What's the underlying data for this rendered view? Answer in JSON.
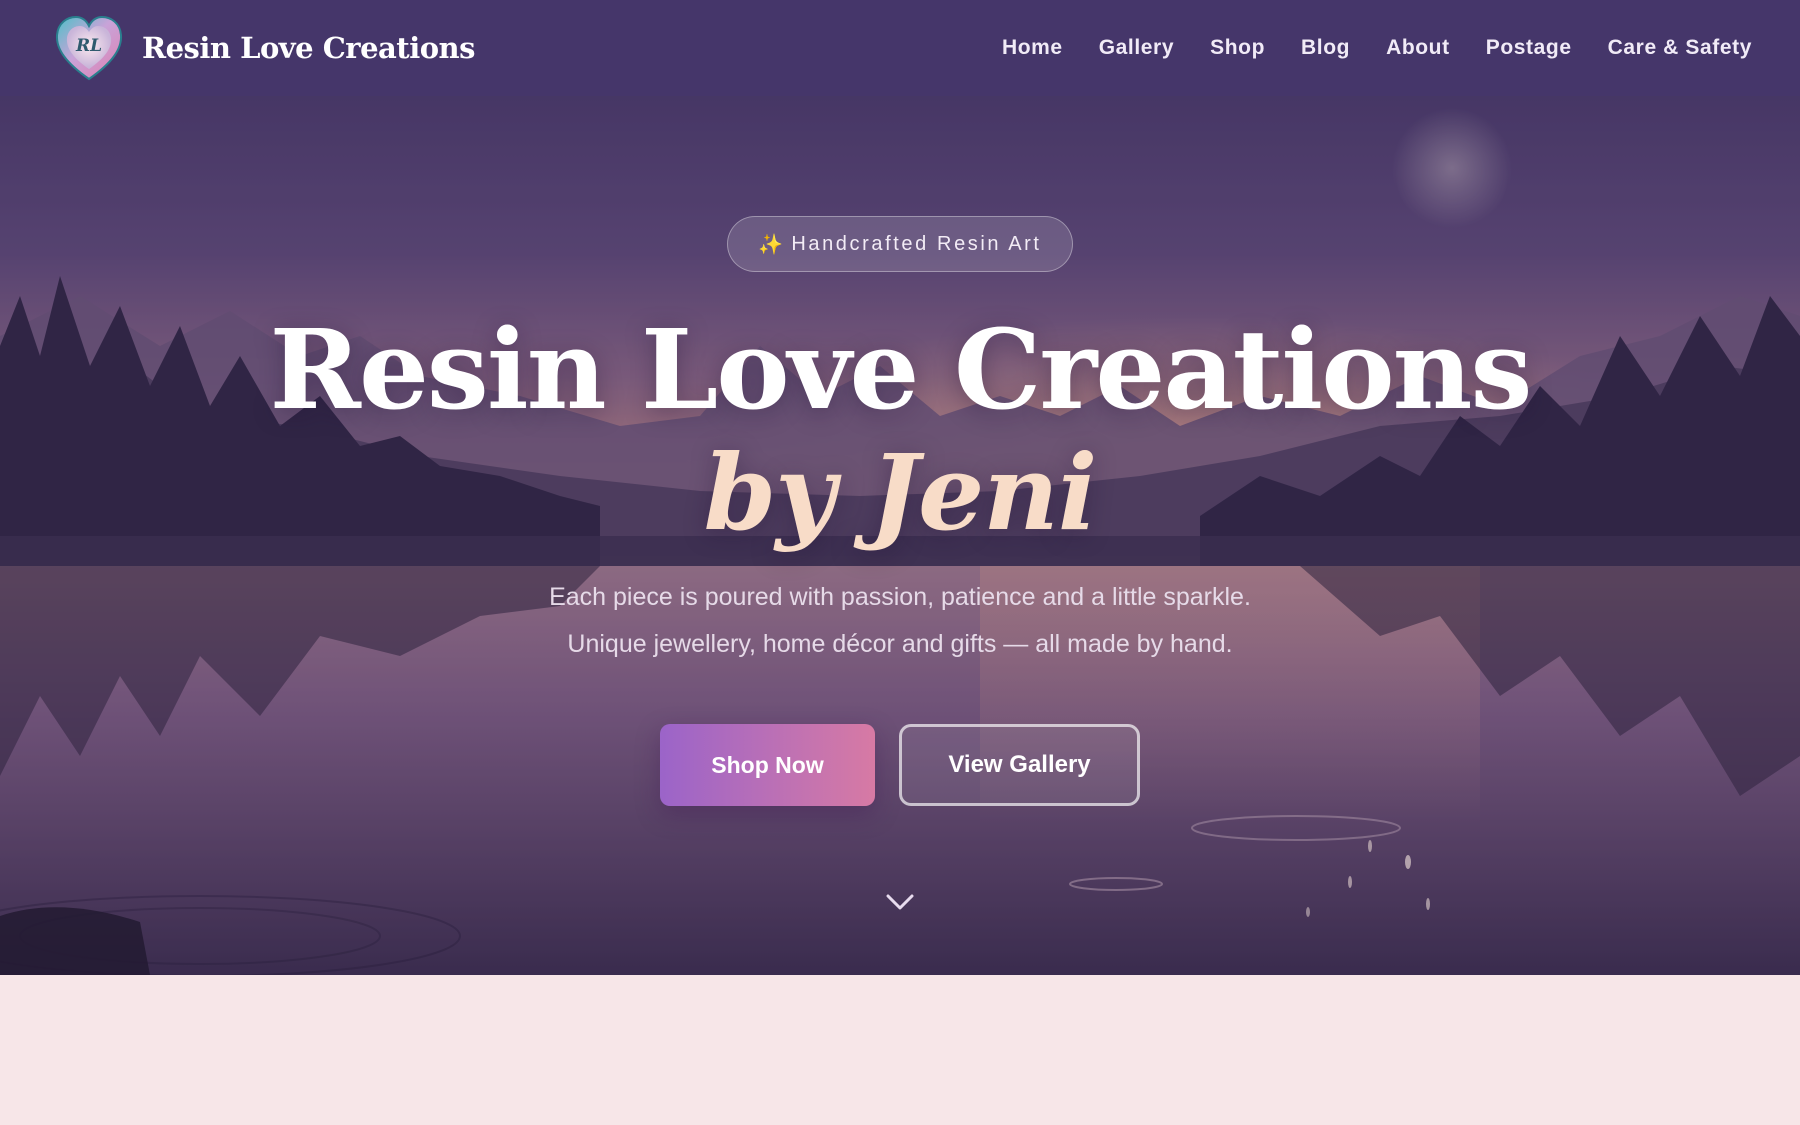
{
  "brand": {
    "name": "Resin Love Creations",
    "logo_monogram": "RL",
    "logo_icon": "heart-logo-icon"
  },
  "nav": {
    "items": [
      {
        "label": "Home"
      },
      {
        "label": "Gallery"
      },
      {
        "label": "Shop"
      },
      {
        "label": "Blog"
      },
      {
        "label": "About"
      },
      {
        "label": "Postage"
      },
      {
        "label": "Care & Safety"
      }
    ]
  },
  "hero": {
    "badge_icon": "✨",
    "badge_text": "Handcrafted Resin Art",
    "title": "Resin Love Creations",
    "subtitle": "by Jeni",
    "tagline_line1": "Each piece is poured with passion, patience and a little sparkle.",
    "tagline_line2": "Unique jewellery, home décor and gifts — all made by hand.",
    "primary_button": "Shop Now",
    "secondary_button": "View Gallery",
    "scroll_icon": "chevron-down-icon"
  },
  "colors": {
    "nav_background": "#45366a",
    "accent_gradient_start": "#9b64c9",
    "accent_gradient_end": "#d77aa4",
    "subtitle": "#f8dcc8",
    "page_background": "#f7e6e8"
  }
}
